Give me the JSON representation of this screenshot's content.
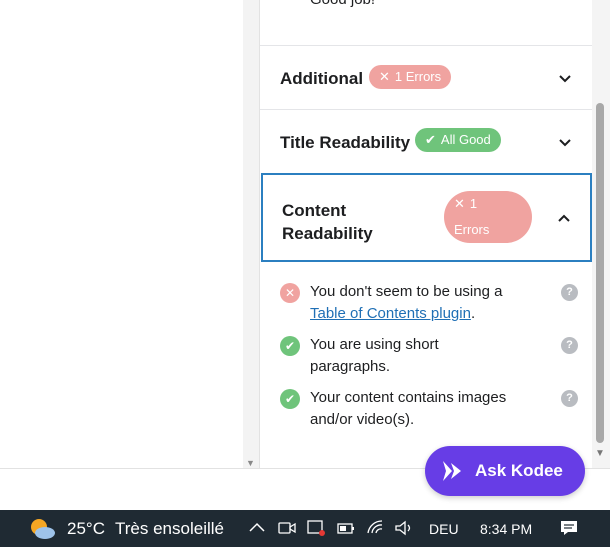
{
  "panel": {
    "partial_text": "Good job!",
    "sections": [
      {
        "title": "Additional",
        "badge_symbol": "✕",
        "badge_text": "1 Errors",
        "badge_type": "error",
        "expanded": false
      },
      {
        "title": "Title Readability",
        "badge_symbol": "✔",
        "badge_text": "All Good",
        "badge_type": "ok",
        "expanded": false
      },
      {
        "title_line1": "Content",
        "title_line2": "Readability",
        "badge_symbol": "✕",
        "badge_line1": "1",
        "badge_line2": "Errors",
        "badge_type": "error",
        "expanded": true
      }
    ],
    "checks": [
      {
        "status": "error",
        "text_before": "You don't seem to be using a",
        "link_text": "Table of Contents plugin",
        "text_after": "."
      },
      {
        "status": "ok",
        "text": "You are using short paragraphs."
      },
      {
        "status": "ok",
        "text": "Your content contains images and/or video(s)."
      }
    ],
    "help_symbol": "?"
  },
  "assistant": {
    "label": "Ask Kodee",
    "color": "#673de6"
  },
  "taskbar": {
    "temperature": "25°C",
    "condition": "Très ensoleillé",
    "language": "DEU",
    "time": "8:34 PM"
  },
  "colors": {
    "error": "#f0a3a0",
    "ok": "#6fc47b",
    "active_border": "#2b7fc0",
    "link": "#1f6fb5"
  }
}
